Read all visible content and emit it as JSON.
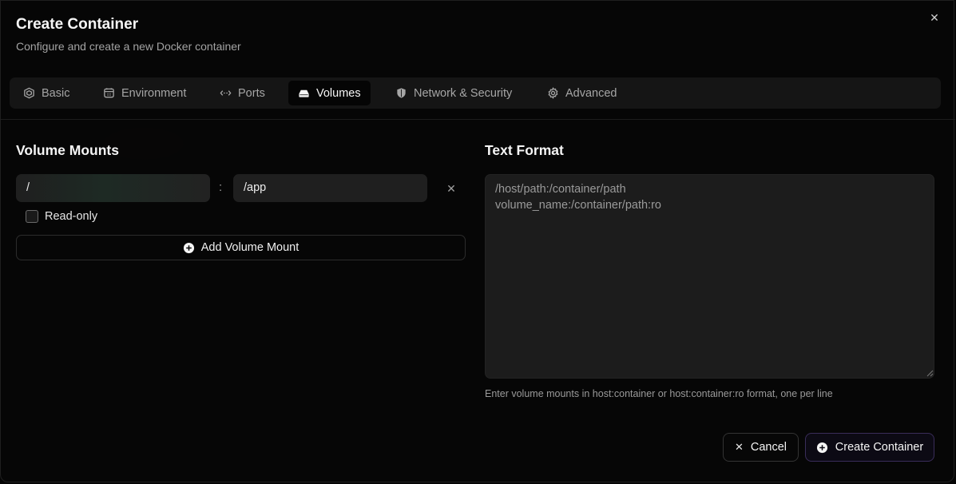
{
  "dialog": {
    "title": "Create Container",
    "subtitle": "Configure and create a new Docker container",
    "close_icon": "x-icon"
  },
  "tabs": [
    {
      "label": "Basic",
      "icon": "box-icon",
      "active": false
    },
    {
      "label": "Environment",
      "icon": "calendar-grid-icon",
      "active": false
    },
    {
      "label": "Ports",
      "icon": "arrows-horizontal-icon",
      "active": false
    },
    {
      "label": "Volumes",
      "icon": "hard-drive-icon",
      "active": true
    },
    {
      "label": "Network & Security",
      "icon": "shield-icon",
      "active": false
    },
    {
      "label": "Advanced",
      "icon": "gear-icon",
      "active": false
    }
  ],
  "volume_mounts": {
    "title": "Volume Mounts",
    "mounts": [
      {
        "host_path": "/",
        "container_path": "/app",
        "separator": ":",
        "read_only": false,
        "read_only_label": "Read-only"
      }
    ],
    "add_label": "Add Volume Mount"
  },
  "text_format": {
    "title": "Text Format",
    "placeholder": "/host/path:/container/path\nvolume_name:/container/path:ro",
    "hint": "Enter volume mounts in host:container or host:container:ro format, one per line"
  },
  "footer": {
    "cancel_label": "Cancel",
    "create_label": "Create Container"
  },
  "colors": {
    "background": "#060606",
    "accent_border": "#3a2d5a",
    "input_bg": "#1f1f1f"
  }
}
